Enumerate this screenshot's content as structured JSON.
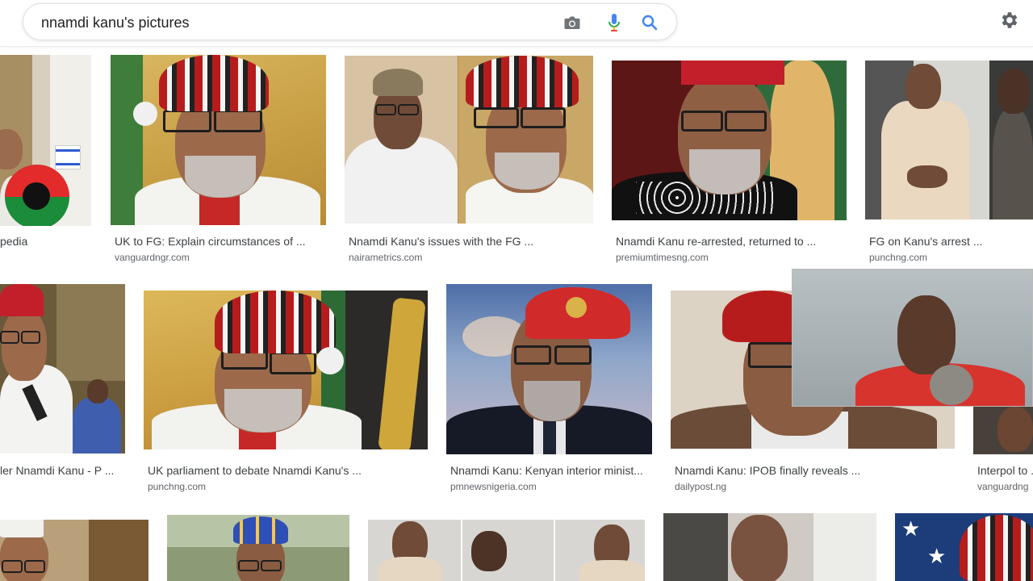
{
  "search": {
    "query": "nnamdi kanu's pictures",
    "camera_icon": "camera-icon",
    "mic_icon": "microphone-icon",
    "search_icon": "search-icon"
  },
  "settings_icon": "gear-icon",
  "colors": {
    "mic_blue": "#4285f4",
    "mic_red": "#ea4335",
    "search_blue": "#4285f4",
    "title_text": "#3c4043",
    "source_text": "#5f6368"
  },
  "results": {
    "row1": [
      {
        "title": "pedia",
        "source": ""
      },
      {
        "title": "UK to FG: Explain circumstances of ...",
        "source": "vanguardngr.com"
      },
      {
        "title": "Nnamdi Kanu's issues with the FG ...",
        "source": "nairametrics.com"
      },
      {
        "title": "Nnamdi Kanu re-arrested, returned to ...",
        "source": "premiumtimesng.com"
      },
      {
        "title": "FG on Kanu's arrest ...",
        "source": "punchng.com"
      }
    ],
    "row2": [
      {
        "title": "ler Nnamdi Kanu - P ...",
        "source": ""
      },
      {
        "title": "UK parliament to debate Nnamdi Kanu's ...",
        "source": "punchng.com"
      },
      {
        "title": "Nnamdi Kanu: Kenyan interior minist...",
        "source": "pmnewsnigeria.com"
      },
      {
        "title": "Nnamdi Kanu: IPOB finally reveals ...",
        "source": "dailypost.ng"
      },
      {
        "title": "Interpol to ...",
        "source": "vanguardng"
      }
    ]
  }
}
